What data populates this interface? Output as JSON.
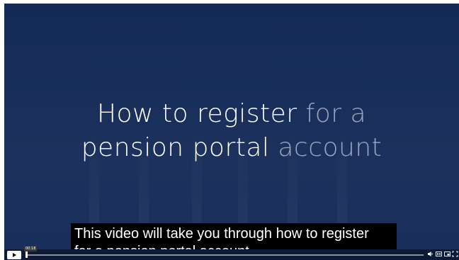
{
  "video": {
    "title_line1_a": "How to ",
    "title_line1_b": "register",
    "title_line1_c": " for a",
    "title_line2_a": "pension portal",
    "title_line2_b": " account"
  },
  "captions": {
    "line1": "This video will take you through how to register",
    "line2": "for a pension portal account"
  },
  "player": {
    "current_time": "00:18",
    "progress_fraction": 0.0,
    "buttons": [
      {
        "name": "play-button",
        "icon": "play-icon"
      },
      {
        "name": "volume-button",
        "icon": "volume-icon"
      },
      {
        "name": "captions-button",
        "icon": "closed-captions-icon"
      },
      {
        "name": "picture-in-picture-button",
        "icon": "picture-in-picture-icon"
      },
      {
        "name": "fullscreen-button",
        "icon": "fullscreen-icon"
      }
    ]
  },
  "colors": {
    "background": "#142a57",
    "title_white": "#ffffff",
    "title_faded": "#9aa6c2",
    "caption_bg": "#000000"
  }
}
